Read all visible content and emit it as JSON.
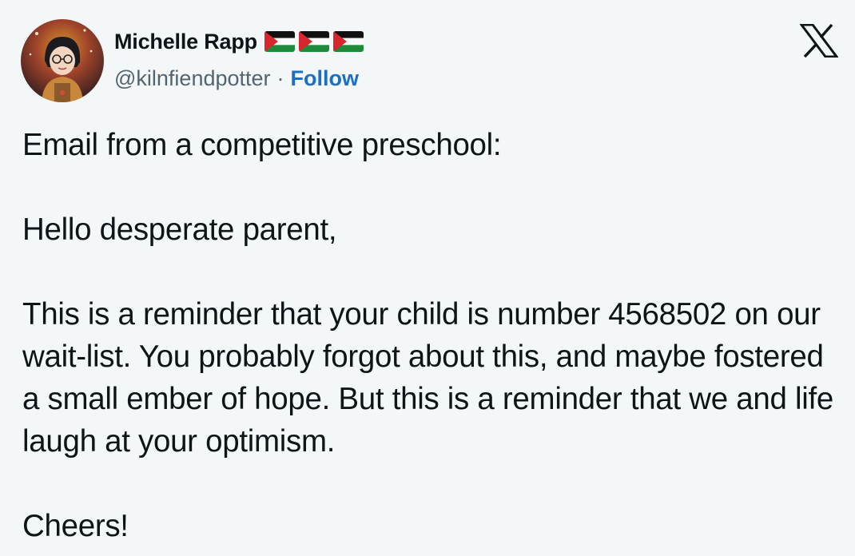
{
  "author": {
    "display_name": "Michelle Rapp",
    "flag_count": 3,
    "flag_icon": "palestine-flag-icon",
    "handle": "@kilnfiendpotter",
    "separator": "·",
    "follow_label": "Follow"
  },
  "brand": {
    "icon": "x-logo-icon"
  },
  "tweet": {
    "line1": "Email from a competitive preschool:",
    "line2": "Hello desperate parent,",
    "line3": "This is a reminder that your child is number 4568502 on our wait-list. You probably forgot about this, and maybe fostered a small ember of hope. But this is a reminder that we and life laugh at your optimism.",
    "line4": "Cheers!"
  },
  "colors": {
    "background": "#f4f7f7",
    "text": "#0f1419",
    "secondary": "#536471",
    "link": "#1d6fc4"
  }
}
